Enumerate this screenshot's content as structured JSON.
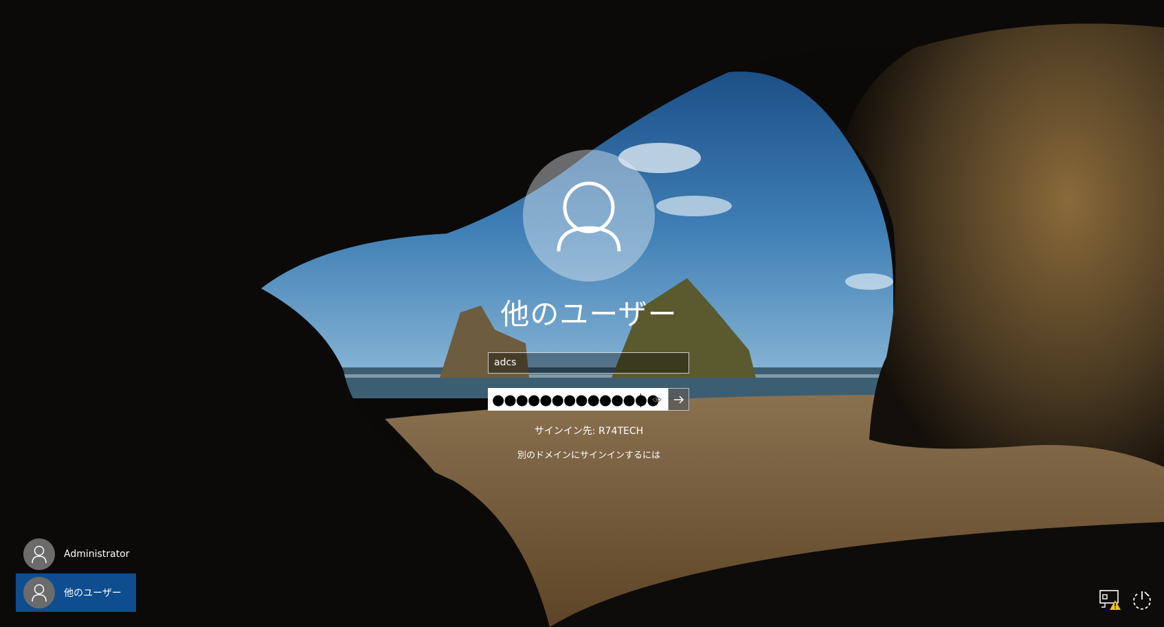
{
  "login": {
    "title": "他のユーザー",
    "username_value": "adcs",
    "password_mask": "●●●●●●●●●●●●●●",
    "sign_in_to": "サインイン先: R74TECH",
    "other_domain_link": "別のドメインにサインインするには"
  },
  "user_list": [
    {
      "name": "Administrator",
      "selected": false
    },
    {
      "name": "他のユーザー",
      "selected": true
    }
  ],
  "icons": {
    "network": "network-warning-icon",
    "power": "power-icon",
    "reveal": "eye-icon",
    "submit": "arrow-right-icon"
  },
  "colors": {
    "selected_user": "#0e4d8f",
    "sky": "#2f6fa8",
    "sand": "#a8844f"
  }
}
